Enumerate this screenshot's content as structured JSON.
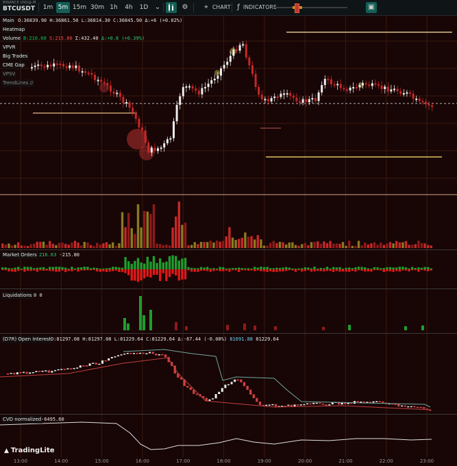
{
  "header": {
    "exchange": "BINANCE USD@-M",
    "symbol": "BTCUSDT",
    "timeframes": [
      "1m",
      "5m",
      "15m",
      "30m",
      "1h",
      "4h",
      "1D"
    ],
    "active_timeframe": "5m",
    "chart_label": "CHART",
    "indicators_label": "INDICATORS"
  },
  "main": {
    "title": "Main",
    "ohlc": "O:36839.90  H:36861.50  L:36814.30  C:36845.90  Δ:+6 (+0.02%)",
    "overlays": [
      "Heatmap",
      "VPVR",
      "Big Trades",
      "CME Gap",
      "VPSV",
      "TrendLines //"
    ]
  },
  "volume": {
    "label": "Volume",
    "b": "B:216.60",
    "s": "S:215.80",
    "sum": "Σ:432.40",
    "delta": "Δ:+0.8 (+0.39%)"
  },
  "market_orders": {
    "label": "Market Orders",
    "buy": "216.63",
    "sell": "-215.80"
  },
  "liquidations": {
    "label": "Liquidations",
    "v1": "0",
    "v2": "0"
  },
  "open_interest": {
    "label": "(D7R) Open Interest",
    "ohlc": "O:81297.08  H:81297.08  L:81229.64  C:81229.64  Δ:-67.44 (-0.08%)",
    "hl": "81691.88",
    "last": "81229.64"
  },
  "cvd": {
    "label": "CVD normalized",
    "value": "-6495.60"
  },
  "x_axis": [
    "13:00",
    "14:00",
    "15:00",
    "16:00",
    "17:00",
    "18:00",
    "19:00",
    "20:00",
    "21:00",
    "22:00",
    "23:00"
  ],
  "footer": {
    "logo": "TradingLite"
  },
  "colors": {
    "up": "#ececec",
    "down": "#c62828",
    "buy": "#1f9d2e",
    "sell": "#e01818",
    "highlight": "#6fd6ff",
    "accent": "#145e55"
  }
}
